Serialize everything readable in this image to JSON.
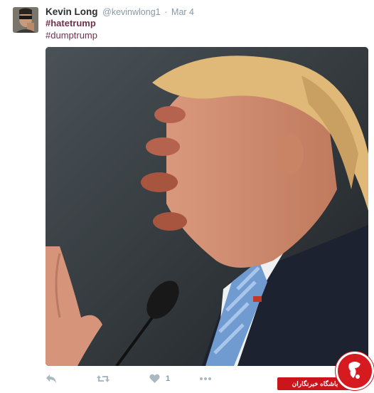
{
  "tweet": {
    "author_name": "Kevin Long",
    "handle": "@kevinwlong1",
    "separator": "·",
    "date": "Mar 4",
    "hashtags": [
      "#hatetrump",
      "#dumptrump"
    ],
    "like_count": "1"
  },
  "icons": {
    "reply": "reply-icon",
    "retweet": "retweet-icon",
    "like": "heart-icon",
    "more": "more-icon"
  },
  "watermark": {
    "text": "باشگاه خبرنگاران"
  },
  "colors": {
    "hashtag": "#70304a",
    "muted": "#8899a6",
    "icon": "#aab8c2",
    "watermark_red": "#c9161b"
  }
}
